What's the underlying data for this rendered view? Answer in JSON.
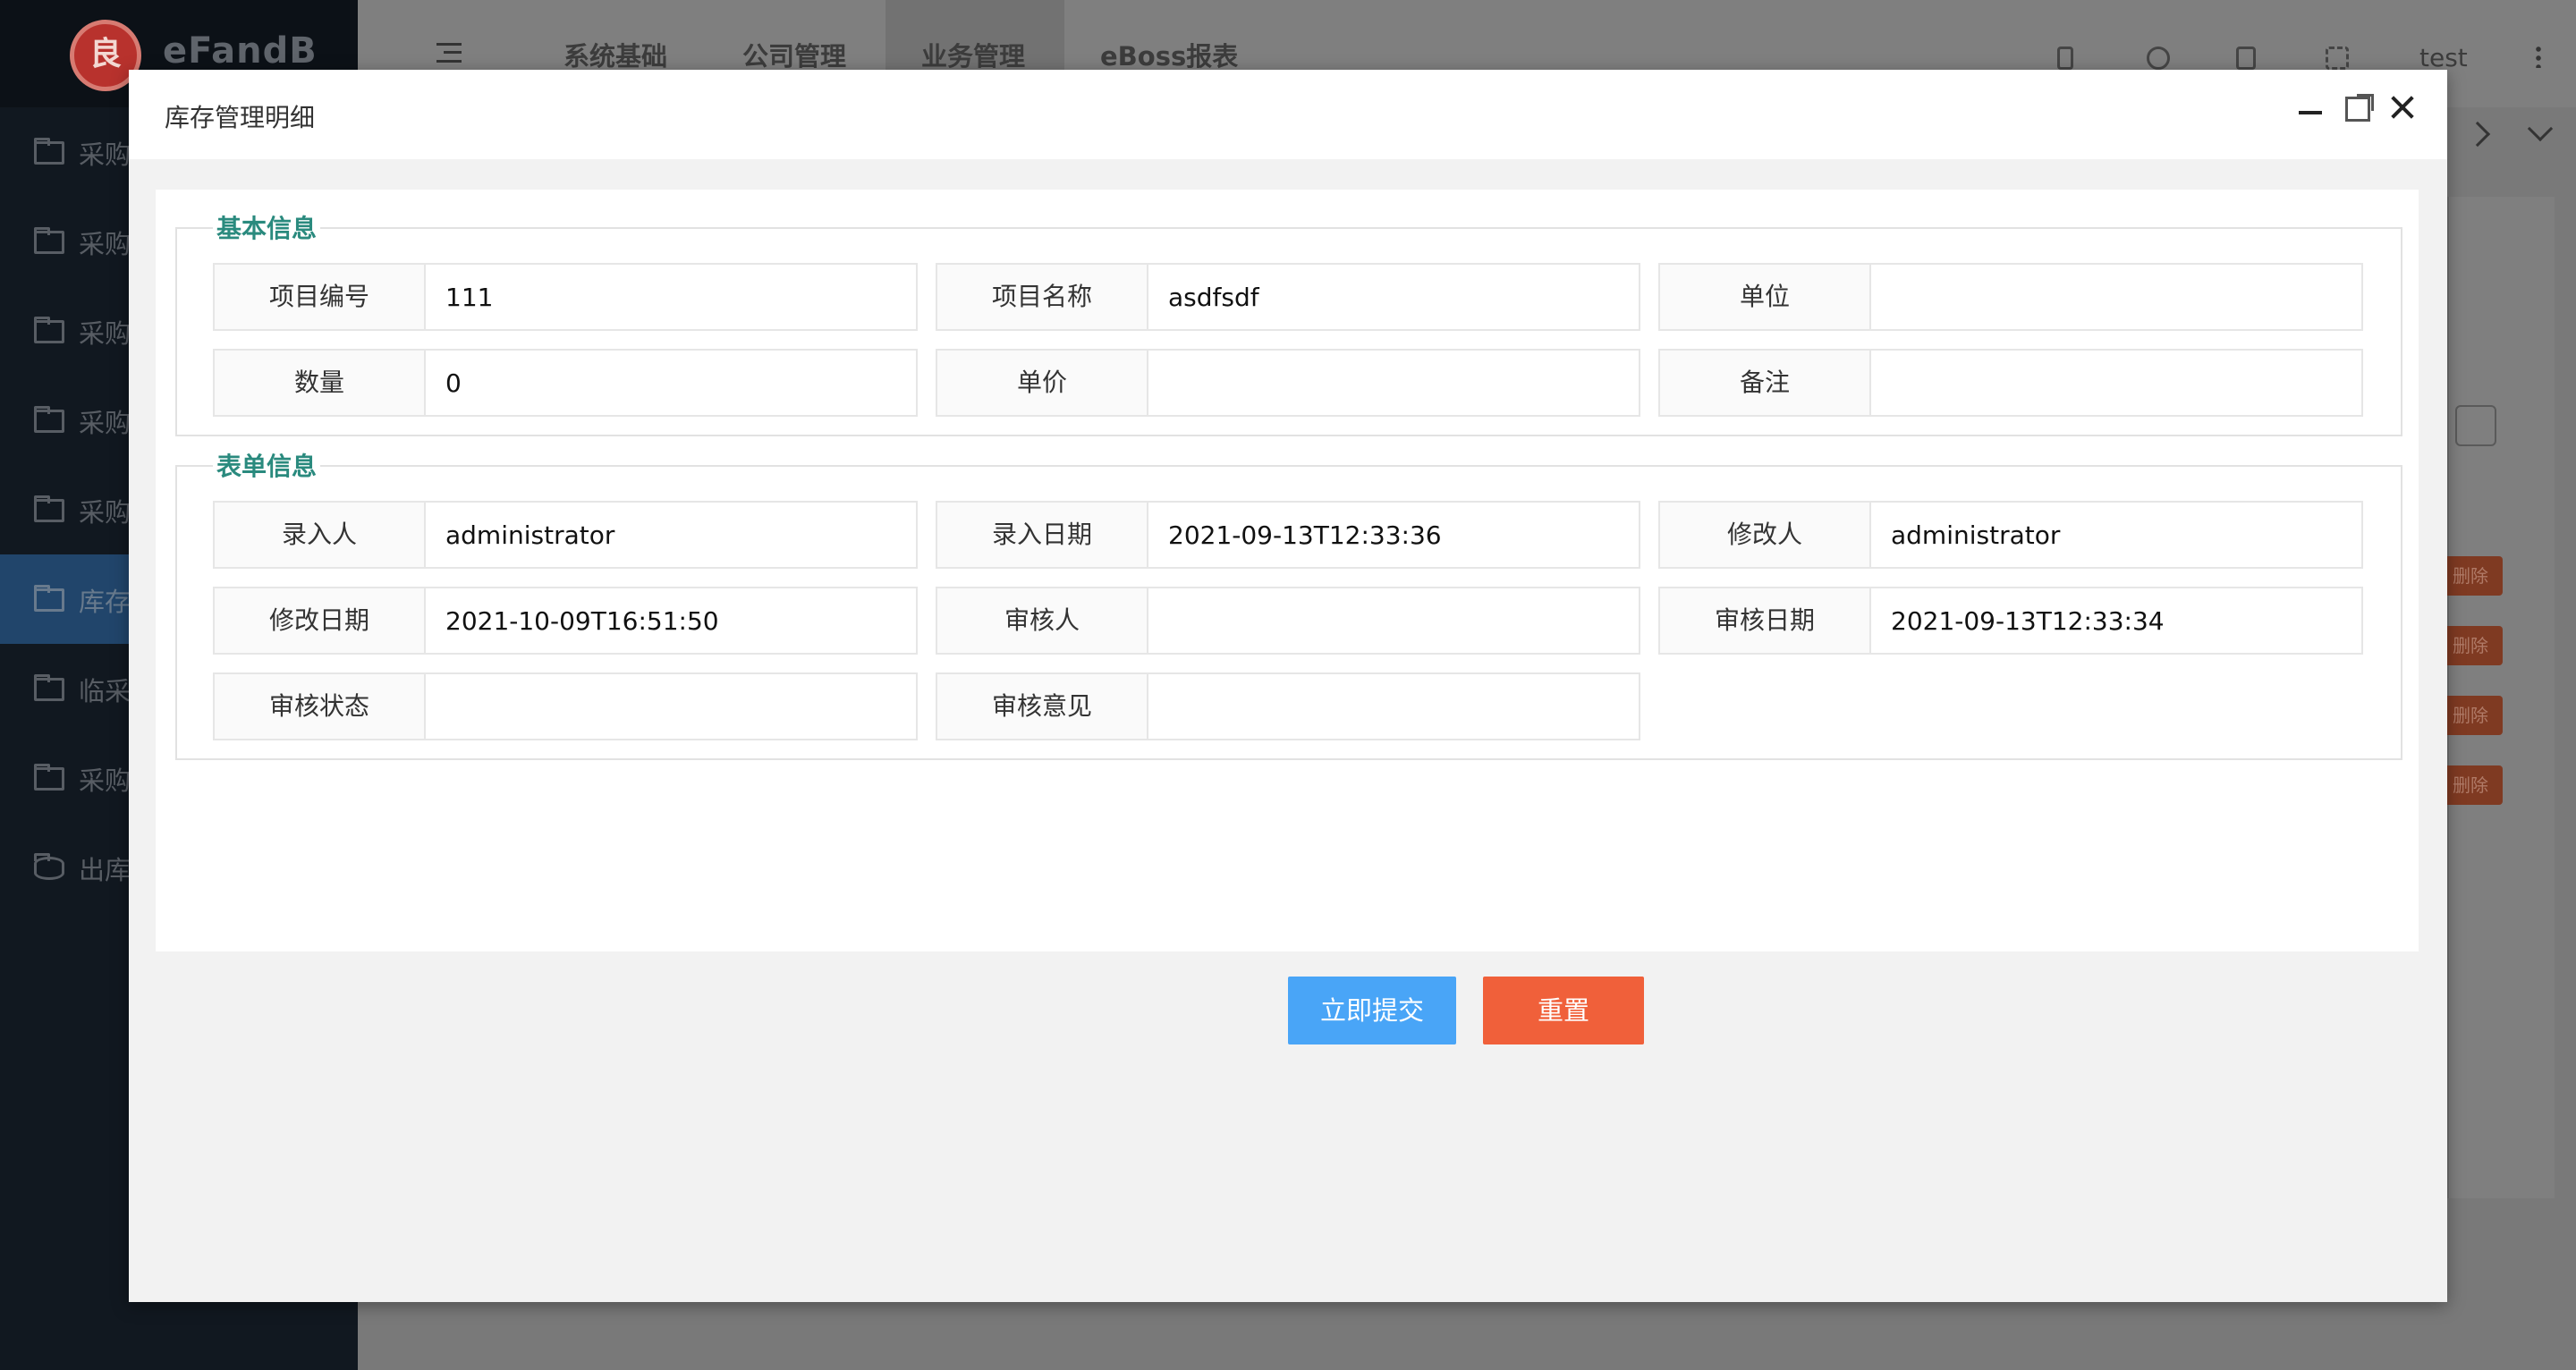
{
  "app": {
    "logo_glyph": "良",
    "logo_text": "eFandB",
    "top_tabs": [
      "系统基础",
      "公司管理",
      "业务管理",
      "eBoss报表"
    ],
    "user_name": "test",
    "sidebar_items": [
      {
        "label": "采购",
        "icon": "folder-icon"
      },
      {
        "label": "采购",
        "icon": "folder-icon"
      },
      {
        "label": "采购",
        "icon": "folder-icon"
      },
      {
        "label": "采购",
        "icon": "folder-icon"
      },
      {
        "label": "采购",
        "icon": "folder-icon"
      },
      {
        "label": "库存",
        "icon": "folder-icon",
        "active": true
      },
      {
        "label": "临采",
        "icon": "folder-icon"
      },
      {
        "label": "采购",
        "icon": "folder-icon"
      },
      {
        "label": "出库",
        "icon": "database-icon"
      }
    ],
    "delete_label": "删除"
  },
  "modal": {
    "title": "库存管理明细",
    "section_basic": {
      "legend": "基本信息",
      "fields": [
        {
          "label": "项目编号",
          "value": "111"
        },
        {
          "label": "项目名称",
          "value": "asdfsdf"
        },
        {
          "label": "单位",
          "value": ""
        },
        {
          "label": "数量",
          "value": "0"
        },
        {
          "label": "单价",
          "value": ""
        },
        {
          "label": "备注",
          "value": ""
        }
      ]
    },
    "section_form": {
      "legend": "表单信息",
      "fields": [
        {
          "label": "录入人",
          "value": "administrator"
        },
        {
          "label": "录入日期",
          "value": "2021-09-13T12:33:36"
        },
        {
          "label": "修改人",
          "value": "administrator"
        },
        {
          "label": "修改日期",
          "value": "2021-10-09T16:51:50"
        },
        {
          "label": "审核人",
          "value": ""
        },
        {
          "label": "审核日期",
          "value": "2021-09-13T12:33:34"
        },
        {
          "label": "审核状态",
          "value": ""
        },
        {
          "label": "审核意见",
          "value": ""
        }
      ]
    },
    "submit_label": "立即提交",
    "reset_label": "重置"
  },
  "colors": {
    "legend": "#2a8a7e",
    "submit": "#49a5f7",
    "reset": "#f0603a"
  }
}
